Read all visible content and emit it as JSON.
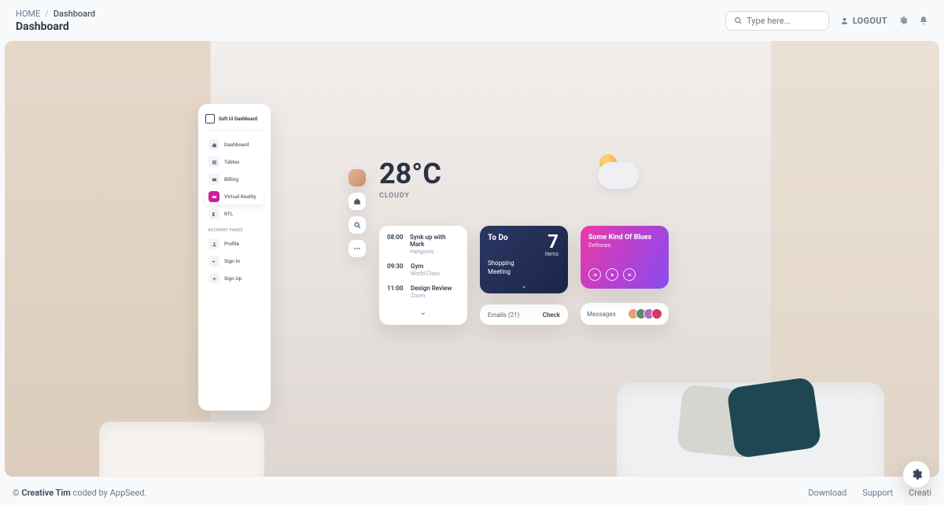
{
  "breadcrumb": {
    "home": "HOME",
    "sep": "/",
    "current": "Dashboard",
    "title": "Dashboard"
  },
  "topbar": {
    "search_placeholder": "Type here...",
    "logout": "LOGOUT"
  },
  "sidebar": {
    "brand": "Soft UI Dashboard",
    "items": [
      {
        "label": "Dashboard"
      },
      {
        "label": "Tables"
      },
      {
        "label": "Billing"
      },
      {
        "label": "Virtual Reality"
      },
      {
        "label": "RTL"
      }
    ],
    "accountHeader": "ACCOUNT PAGES",
    "account": [
      {
        "label": "Profile"
      },
      {
        "label": "Sign In"
      },
      {
        "label": "Sign Up"
      }
    ]
  },
  "weather": {
    "temp": "28°C",
    "label": "CLOUDY"
  },
  "schedule": {
    "events": [
      {
        "time": "08:00",
        "title": "Synk up with Mark",
        "sub": "Hangouts"
      },
      {
        "time": "09:30",
        "title": "Gym",
        "sub": "World Class"
      },
      {
        "time": "11:00",
        "title": "Design Review",
        "sub": "Zoom"
      }
    ]
  },
  "todo": {
    "title": "To Do",
    "count": "7",
    "items_label": "items",
    "meeting": "Shopping\nMeeting"
  },
  "emails": {
    "label": "Emails (21)",
    "action": "Check"
  },
  "music": {
    "title": "Some Kind Of Blues",
    "artist": "Deftones"
  },
  "messages": {
    "label": "Messages"
  },
  "footer": {
    "copy_prefix": "© ",
    "brand": "Creative Tim",
    "copy_suffix": " coded by AppSeed.",
    "links": [
      "Download",
      "Support",
      "Creati"
    ]
  }
}
